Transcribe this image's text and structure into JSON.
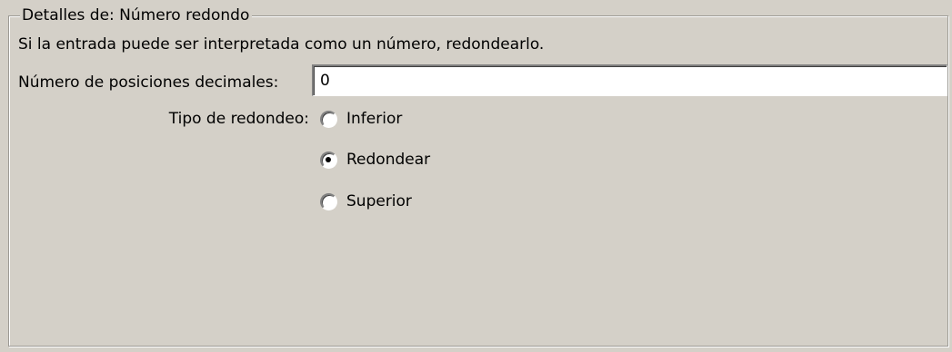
{
  "group": {
    "legend": "Detalles de: Número redondo",
    "description": "Si la entrada puede ser interpretada como un número, redondearlo."
  },
  "decimals": {
    "label": "Número de posiciones decimales:",
    "value": "0"
  },
  "rounding": {
    "label": "Tipo de redondeo:",
    "options": [
      {
        "label": "Inferior",
        "checked": false
      },
      {
        "label": "Redondear",
        "checked": true
      },
      {
        "label": "Superior",
        "checked": false
      }
    ]
  }
}
